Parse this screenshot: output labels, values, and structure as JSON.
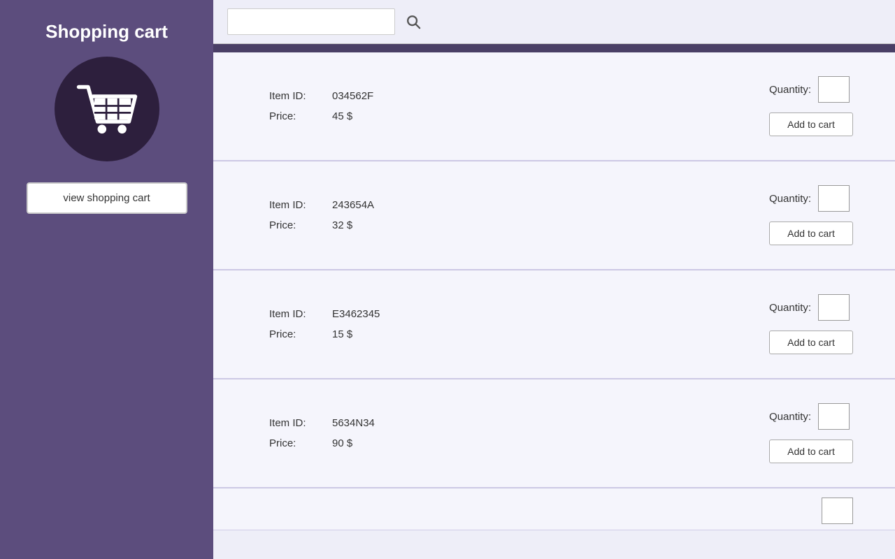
{
  "sidebar": {
    "title": "Shopping cart",
    "view_cart_label": "view shopping cart",
    "cart_icon_name": "shopping-cart-icon"
  },
  "search": {
    "placeholder": "",
    "search_icon": "search-icon"
  },
  "items": [
    {
      "item_id_label": "Item ID:",
      "item_id_value": "034562F",
      "price_label": "Price:",
      "price_value": "45 $",
      "quantity_label": "Quantity:",
      "quantity_value": "",
      "add_to_cart_label": "Add to cart"
    },
    {
      "item_id_label": "Item ID:",
      "item_id_value": "243654A",
      "price_label": "Price:",
      "price_value": "32 $",
      "quantity_label": "Quantity:",
      "quantity_value": "",
      "add_to_cart_label": "Add to cart"
    },
    {
      "item_id_label": "Item ID:",
      "item_id_value": "E3462345",
      "price_label": "Price:",
      "price_value": "15 $",
      "quantity_label": "Quantity:",
      "quantity_value": "",
      "add_to_cart_label": "Add to cart"
    },
    {
      "item_id_label": "Item ID:",
      "item_id_value": "5634N34",
      "price_label": "Price:",
      "price_value": "90 $",
      "quantity_label": "Quantity:",
      "quantity_value": "",
      "add_to_cart_label": "Add to cart"
    }
  ]
}
